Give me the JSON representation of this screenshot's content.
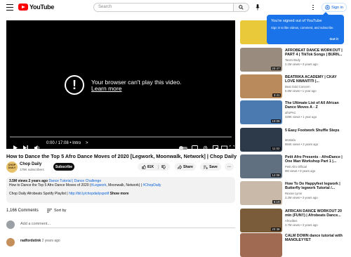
{
  "header": {
    "logo_text": "YouTube",
    "search_placeholder": "Search",
    "sign_in_label": "Sign in"
  },
  "player": {
    "error_message": "Your browser can't play this video.",
    "learn_more": "Learn more",
    "time": "0:00 / 17:08 • Intro",
    "time_arrow": ">"
  },
  "video": {
    "title": "How to Dance the Top 5 Afro Dance Moves of 2020 [Legwork, Moonwalk, Network] | Chop Daily",
    "channel": {
      "name": "Chop Daily",
      "subscribers": "179K subscribers",
      "avatar_text": "CHOP DAILY"
    },
    "subscribe_label": "Subscribe",
    "likes": "81K",
    "share_label": "Share",
    "save_label": "Save",
    "description": {
      "stats": "3.5M views  2 years ago",
      "tag": "Dance Tutorial | Dance Challenge",
      "line1_prefix": "How to Dance the Top 5 Afro Dance Moves of 2020 (",
      "hashtag1": "#Legwork",
      "line1_mid": ", Moonwalk, Network) | ",
      "hashtag2": "#ChopDaily",
      "line2_prefix": "Chop Daily Afrobeats Spotify Playlist | ",
      "link": "http://bit.ly/chopdailyspotif",
      "show_more": "Show more"
    }
  },
  "comments": {
    "count": "1,166 Comments",
    "sort_label": "Sort by",
    "add_placeholder": "Add a comment...",
    "first_user": "radfordstink",
    "first_time": "2 years ago"
  },
  "popup": {
    "title": "You're signed out of YouTube",
    "subtitle": "Sign in to like videos, comment, and subscribe.",
    "button": "Got it"
  },
  "sidebar": [
    {
      "title": "",
      "channel": "",
      "meta": "",
      "duration": "",
      "thumb_color": "#e9c93a"
    },
    {
      "title": "AFROBEAT DANCE WORKOUT | PART 4 | TikTok Songs | BURN...",
      "channel": "Tara's Body",
      "meta": "2.1M views • 3 years ago",
      "duration": "20:47",
      "thumb_color": "#9a8b7f"
    },
    {
      "title": "BEATRIKA ACADEMY | CKAY LOVE NWANTITI |...",
      "channel": "Beat Gold Concern",
      "meta": "6.6M views • 1 year ago",
      "duration": "3:41",
      "thumb_color": "#b98a5c"
    },
    {
      "title": "The Ultimate List of All African Dance Moves A - Z",
      "channel": "afroPAC",
      "meta": "329K views • 1 year ago",
      "duration": "10:09",
      "thumb_color": "#4b7ab0"
    },
    {
      "title": "5 Easy Footwork Shuffle Steps",
      "channel": "Mostafa",
      "meta": "884K views • 3 years ago",
      "duration": "11:02",
      "thumb_color": "#2d3a4a"
    },
    {
      "title": "Petit Afro Presents - AfroDance | One Man Workshop Part 1 |...",
      "channel": "Petit Afro Official",
      "meta": "9M views • 9 years ago",
      "duration": "12:08",
      "thumb_color": "#607080"
    },
    {
      "title": "How To Do Happyfeet legwork | Butterfly legwork Tutorial /...",
      "channel": "Rexxie Lyron",
      "meta": "3.2M views • 3 years ago",
      "duration": "6:19",
      "thumb_color": "#c8b9a8"
    },
    {
      "title": "AFRICAN DANCE WORKOUT 20 min (FUN!!) | Afrobeats Dance...",
      "channel": "Afrovibes",
      "meta": "2.7M views • 3 years ago",
      "duration": "20:38",
      "thumb_color": "#7a5c3a"
    },
    {
      "title": "CALM DOWN dance tutorial with MANOLEYYET",
      "channel": "",
      "meta": "",
      "duration": "",
      "thumb_color": "#a06a52"
    }
  ]
}
